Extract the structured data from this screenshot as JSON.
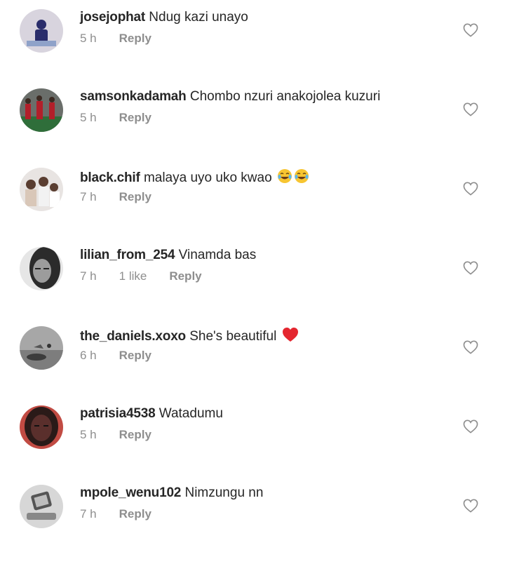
{
  "comments": [
    {
      "username": "josejophat",
      "text": "Ndug kazi unayo",
      "time": "5 h",
      "likes": "",
      "reply": "Reply",
      "emoji": "",
      "avatar_colors": [
        "#d8d4de",
        "#2a2d6b"
      ]
    },
    {
      "username": "samsonkadamah",
      "text": "Chombo nzuri anakojolea kuzuri",
      "time": "5 h",
      "likes": "",
      "reply": "Reply",
      "emoji": "",
      "avatar_colors": [
        "#b21f2a",
        "#2f6e3a"
      ]
    },
    {
      "username": "black.chif",
      "text": "malaya uyo uko kwao",
      "time": "7 h",
      "likes": "",
      "reply": "Reply",
      "emoji": "laugh-tears x2",
      "avatar_colors": [
        "#d9c7b8",
        "#5a3e31"
      ]
    },
    {
      "username": "lilian_from_254",
      "text": "Vinamda bas",
      "time": "7 h",
      "likes": "1 like",
      "reply": "Reply",
      "emoji": "",
      "avatar_colors": [
        "#2b2b2b",
        "#e6e6e6"
      ]
    },
    {
      "username": "the_daniels.xoxo",
      "text": "She's beautiful",
      "time": "6 h",
      "likes": "",
      "reply": "Reply",
      "emoji": "red-heart",
      "avatar_colors": [
        "#9a9a9a",
        "#3c3c3c"
      ]
    },
    {
      "username": "patrisia4538",
      "text": "Watadumu",
      "time": "5 h",
      "likes": "",
      "reply": "Reply",
      "emoji": "",
      "avatar_colors": [
        "#5a2f2c",
        "#c14b43"
      ]
    },
    {
      "username": "mpole_wenu102",
      "text": "Nimzungu nn",
      "time": "7 h",
      "likes": "",
      "reply": "Reply",
      "emoji": "",
      "avatar_colors": [
        "#d7d7d7",
        "#555555"
      ]
    }
  ]
}
